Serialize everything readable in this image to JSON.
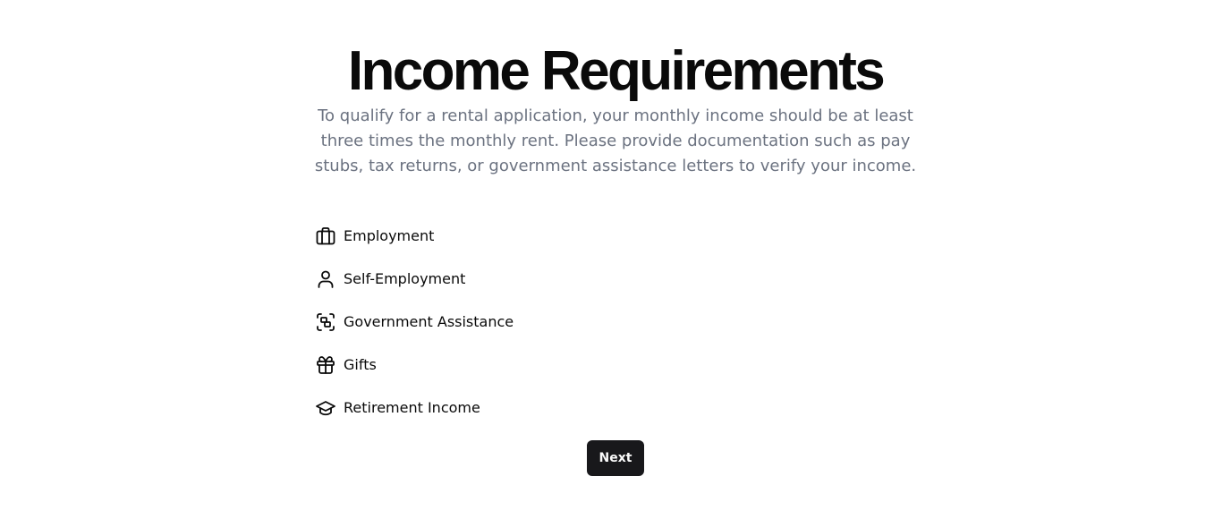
{
  "header": {
    "title": "Income Requirements",
    "description": "To qualify for a rental application, your monthly income should be at least three times the monthly rent. Please provide documentation such as pay stubs, tax returns, or government assistance letters to verify your income."
  },
  "income_options": [
    {
      "label": "Employment",
      "icon": "briefcase-icon"
    },
    {
      "label": "Self-Employment",
      "icon": "user-icon"
    },
    {
      "label": "Government Assistance",
      "icon": "scan-icon"
    },
    {
      "label": "Gifts",
      "icon": "gift-icon"
    },
    {
      "label": "Retirement Income",
      "icon": "graduation-cap-icon"
    }
  ],
  "actions": {
    "next_label": "Next"
  },
  "colors": {
    "title": "#0a0a0a",
    "description": "#6b7280",
    "button_bg": "#18181b",
    "button_text": "#fafafa"
  }
}
